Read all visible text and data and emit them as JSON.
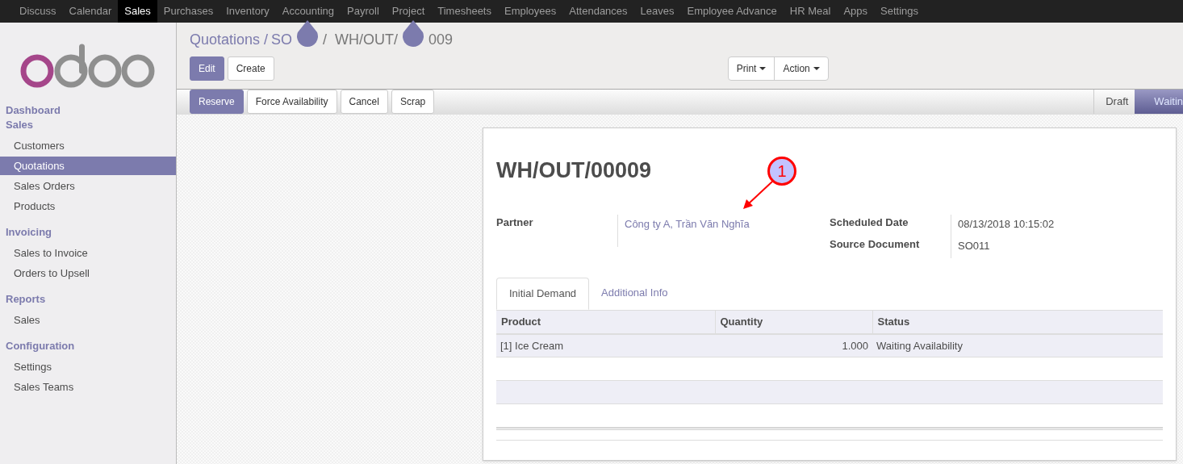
{
  "top_menu": [
    {
      "label": "Discuss",
      "selected": false
    },
    {
      "label": "Calendar",
      "selected": false
    },
    {
      "label": "Sales",
      "selected": true
    },
    {
      "label": "Purchases",
      "selected": false
    },
    {
      "label": "Inventory",
      "selected": false
    },
    {
      "label": "Accounting",
      "selected": false
    },
    {
      "label": "Payroll",
      "selected": false
    },
    {
      "label": "Project",
      "selected": false
    },
    {
      "label": "Timesheets",
      "selected": false
    },
    {
      "label": "Employees",
      "selected": false
    },
    {
      "label": "Attendances",
      "selected": false
    },
    {
      "label": "Leaves",
      "selected": false
    },
    {
      "label": "Employee Advance",
      "selected": false
    },
    {
      "label": "HR Meal",
      "selected": false
    },
    {
      "label": "Apps",
      "selected": false
    },
    {
      "label": "Settings",
      "selected": false
    }
  ],
  "sidebar": {
    "sections": [
      {
        "title": "Dashboard"
      },
      {
        "title": "Sales",
        "items": [
          {
            "label": "Customers",
            "selected": false
          },
          {
            "label": "Quotations",
            "selected": true
          },
          {
            "label": "Sales Orders",
            "selected": false
          },
          {
            "label": "Products",
            "selected": false
          }
        ]
      },
      {
        "title": "Invoicing",
        "items": [
          {
            "label": "Sales to Invoice",
            "selected": false
          },
          {
            "label": "Orders to Upsell",
            "selected": false
          }
        ]
      },
      {
        "title": "Reports",
        "items": [
          {
            "label": "Sales",
            "selected": false
          }
        ]
      },
      {
        "title": "Configuration",
        "items": [
          {
            "label": "Settings",
            "selected": false
          },
          {
            "label": "Sales Teams",
            "selected": false
          }
        ]
      }
    ]
  },
  "breadcrumb": [
    {
      "kind": "link",
      "label": "Quotations /"
    },
    {
      "kind": "link",
      "label": "SO"
    },
    {
      "kind": "marker"
    },
    {
      "kind": "text",
      "label": "/  WH/OUT/"
    },
    {
      "kind": "marker"
    },
    {
      "kind": "text",
      "label": "009"
    }
  ],
  "buttons": [
    {
      "label": "Edit",
      "primary": true
    },
    {
      "label": "Create",
      "primary": false
    }
  ],
  "dropdowns": [
    "Print",
    "Action"
  ],
  "status_buttons": [
    {
      "label": "Reserve",
      "primary": true
    },
    {
      "label": "Force Availability",
      "primary": false
    },
    {
      "label": "Cancel",
      "primary": false
    },
    {
      "label": "Scrap",
      "primary": false
    }
  ],
  "stages": [
    {
      "label": "Draft",
      "selected": false
    },
    {
      "label": "Waitin",
      "selected": true
    }
  ],
  "sheet": {
    "title": "WH/OUT/00009",
    "left_fields": [
      {
        "label": "Partner",
        "value": "Công ty A, Trần Văn Nghĩa"
      }
    ],
    "right_fields": [
      {
        "label": "Scheduled Date",
        "value": "08/13/2018 10:15:02"
      },
      {
        "label": "Source Document",
        "value": "SO011"
      }
    ],
    "annotation": "1",
    "tabs": [
      {
        "label": "Initial Demand",
        "selected": true
      },
      {
        "label": "Additional Info",
        "selected": false
      }
    ],
    "table": {
      "columns": [
        "Product",
        "Quantity",
        "Status"
      ],
      "rows": [
        [
          "[1] Ice Cream",
          "1.000",
          "Waiting Availability"
        ]
      ]
    }
  }
}
